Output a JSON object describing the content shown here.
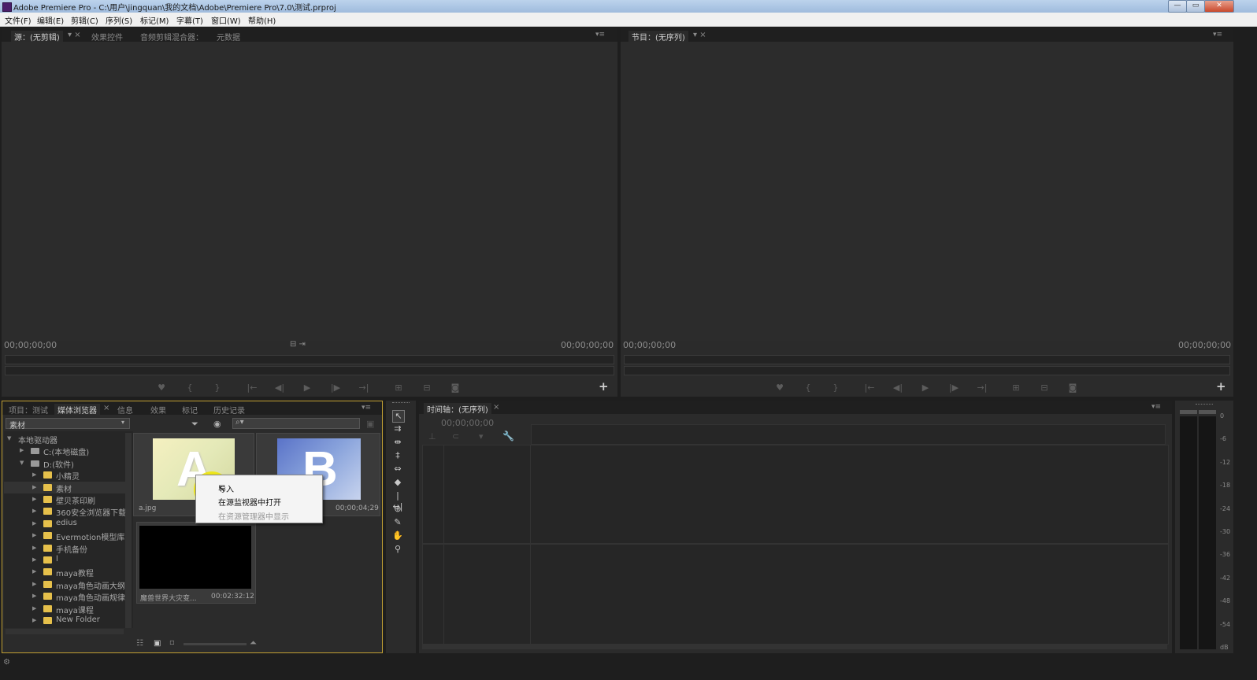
{
  "app": {
    "title": "Adobe Premiere Pro - C:\\用户\\jingquan\\我的文档\\Adobe\\Premiere Pro\\7.0\\测试.prproj",
    "min": "—",
    "max": "▭",
    "close": "✕"
  },
  "menu": [
    "文件(F)",
    "编辑(E)",
    "剪辑(C)",
    "序列(S)",
    "标记(M)",
    "字幕(T)",
    "窗口(W)",
    "帮助(H)"
  ],
  "source_panel": {
    "tabs": [
      "源：(无剪辑)",
      "效果控件",
      "音频剪辑混合器：",
      "元数据"
    ],
    "timecode_left": "00;00;00;00",
    "timecode_right": "00;00;00;00"
  },
  "program_panel": {
    "tab": "节目：(无序列)",
    "timecode_left": "00;00;00;00",
    "timecode_right": "00;00;00;00"
  },
  "controls": [
    "♥",
    "{",
    "}",
    "|←",
    "◀|",
    "▶",
    "|▶",
    "→|",
    "⊞",
    "⊟",
    "◙"
  ],
  "project_panel": {
    "tabs": [
      "项目：测试",
      "媒体浏览器",
      "信息",
      "效果",
      "标记",
      "历史记录"
    ],
    "dropdown": "素材",
    "tree": [
      {
        "label": "本地驱动器",
        "level": 0,
        "type": "root",
        "open": true
      },
      {
        "label": "C:(本地磁盘)",
        "level": 1,
        "type": "drive",
        "open": false
      },
      {
        "label": "D:(软件)",
        "level": 1,
        "type": "drive",
        "open": true
      },
      {
        "label": "小精灵",
        "level": 2,
        "type": "folder"
      },
      {
        "label": "素材",
        "level": 2,
        "type": "folder",
        "selected": true
      },
      {
        "label": "壁贝茶印刷",
        "level": 2,
        "type": "folder"
      },
      {
        "label": "360安全浏览器下载",
        "level": 2,
        "type": "folder"
      },
      {
        "label": "edius",
        "level": 2,
        "type": "folder"
      },
      {
        "label": "Evermotion模型库",
        "level": 2,
        "type": "folder"
      },
      {
        "label": "手机备份",
        "level": 2,
        "type": "folder"
      },
      {
        "label": "l",
        "level": 2,
        "type": "folder"
      },
      {
        "label": "maya教程",
        "level": 2,
        "type": "folder"
      },
      {
        "label": "maya角色动画大纲",
        "level": 2,
        "type": "folder"
      },
      {
        "label": "maya角色动画规律",
        "level": 2,
        "type": "folder"
      },
      {
        "label": "maya课程",
        "level": 2,
        "type": "folder"
      },
      {
        "label": "New Folder",
        "level": 2,
        "type": "folder"
      }
    ],
    "thumbs": [
      {
        "letter": "A",
        "name": "a.jpg",
        "duration": ""
      },
      {
        "letter": "B",
        "name": "",
        "duration": "00;00;04;29"
      },
      {
        "letter": "",
        "name": "魔兽世界大灾变...",
        "duration": "00:02:32:12"
      }
    ]
  },
  "context_menu": [
    "导入",
    "在源监视器中打开",
    "在资源管理器中显示"
  ],
  "timeline": {
    "tab": "时间轴：(无序列)",
    "timecode": "00;00;00;00"
  },
  "meter_labels": [
    "0",
    "-6",
    "-12",
    "-18",
    "-24",
    "-30",
    "-36",
    "-42",
    "-48",
    "-54",
    "dB"
  ],
  "colors": {
    "bg": "#1e1e1e",
    "panel": "#2b2b2b",
    "active_border": "#c2a033",
    "folder": "#e6c04b",
    "highlight": "#f1e600"
  }
}
